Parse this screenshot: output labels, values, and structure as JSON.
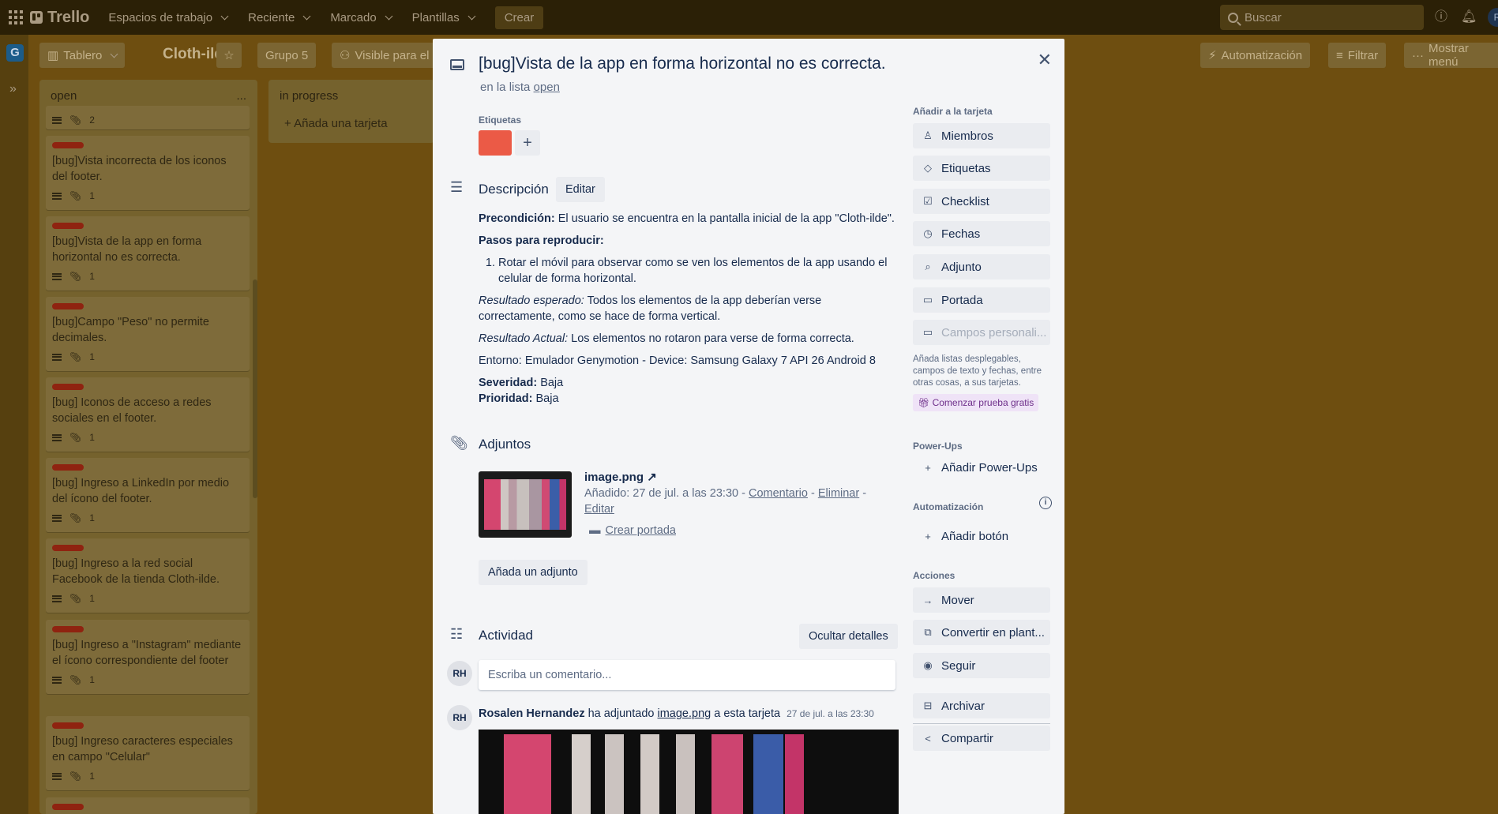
{
  "topbar": {
    "logo": "Trello",
    "nav": [
      "Espacios de trabajo",
      "Reciente",
      "Marcado",
      "Plantillas"
    ],
    "create": "Crear",
    "search_placeholder": "Buscar",
    "avatar": "R"
  },
  "board": {
    "workspace_initial": "G",
    "view_button": "Tablero",
    "title": "Cloth-ilde",
    "group": "Grupo 5",
    "visibility": "Visible para el",
    "automation": "Automatización",
    "filter": "Filtrar",
    "menu": "Mostrar menú"
  },
  "lists": {
    "open": {
      "title": "open",
      "menu": "...",
      "partial_count": "2",
      "cards": [
        {
          "title": "[bug]Vista incorrecta de los iconos del footer.",
          "attachments": "1"
        },
        {
          "title": "[bug]Vista de la app en forma horizontal no es correcta.",
          "attachments": "1"
        },
        {
          "title": "[bug]Campo \"Peso\" no permite decimales.",
          "attachments": "1"
        },
        {
          "title": "[bug] Iconos de acceso a redes sociales en el footer.",
          "attachments": "1"
        },
        {
          "title": "[bug] Ingreso a LinkedIn por medio del ícono del footer.",
          "attachments": "1"
        },
        {
          "title": "[bug] Ingreso a la red social Facebook de la tienda Cloth-ilde.",
          "attachments": "1"
        },
        {
          "title": "[bug] Ingreso a \"Instagram\" mediante el ícono correspondiente del footer",
          "attachments": "1"
        },
        {
          "title": "[bug] Ingreso caracteres especiales en campo \"Celular\"",
          "attachments": "1"
        }
      ]
    },
    "in_progress": {
      "title": "in progress",
      "add_card": "Añada una tarjeta"
    }
  },
  "modal": {
    "title": "[bug]Vista de la app en forma horizontal no es correcta.",
    "in_list_prefix": "en la lista",
    "in_list": "open",
    "labels_heading": "Etiquetas",
    "label_color": "#eb5a46",
    "description": {
      "heading": "Descripción",
      "edit": "Editar",
      "precondition_label": "Precondición:",
      "precondition": "El usuario se encuentra en la pantalla inicial de la app \"Cloth-ilde\".",
      "steps_label": "Pasos para reproducir:",
      "step_1": "Rotar el móvil para observar como se ven los elementos de la app usando el celular de forma horizontal.",
      "expected_label": "Resultado esperado:",
      "expected": "Todos los elementos de la app deberían verse correctamente, como se hace de forma vertical.",
      "actual_label": "Resultado Actual:",
      "actual": "Los elementos no rotaron para verse de forma correcta.",
      "environment": "Entorno: Emulador Genymotion - Device: Samsung Galaxy 7 API 26 Android 8",
      "severity_label": "Severidad:",
      "severity": "Baja",
      "priority_label": "Prioridad:",
      "priority": "Baja"
    },
    "attachments": {
      "heading": "Adjuntos",
      "file_name": "image.png",
      "added": "Añadido: 27 de jul. a las 23:30 -",
      "comment": "Comentario",
      "delete": "Eliminar",
      "edit": "Editar",
      "make_cover": "Crear portada",
      "add": "Añada un adjunto"
    },
    "activity": {
      "heading": "Actividad",
      "hide_details": "Ocultar detalles",
      "avatar": "RH",
      "comment_placeholder": "Escriba un comentario...",
      "author": "Rosalen Hernandez",
      "action": "ha adjuntado",
      "file": "image.png",
      "suffix": "a esta tarjeta",
      "time": "27 de jul. a las 23:30"
    },
    "sidebar": {
      "add_heading": "Añadir a la tarjeta",
      "members": "Miembros",
      "labels": "Etiquetas",
      "checklist": "Checklist",
      "dates": "Fechas",
      "attachment": "Adjunto",
      "cover": "Portada",
      "custom_fields": "Campos personali...",
      "hint": "Añada listas desplegables, campos de texto y fechas, entre otras cosas, a sus tarjetas.",
      "trial": "Comenzar prueba gratis",
      "powerups_heading": "Power-Ups",
      "add_powerups": "Añadir Power-Ups",
      "automation_heading": "Automatización",
      "add_button": "Añadir botón",
      "actions_heading": "Acciones",
      "move": "Mover",
      "template": "Convertir en plant...",
      "follow": "Seguir",
      "archive": "Archivar",
      "share": "Compartir"
    }
  }
}
